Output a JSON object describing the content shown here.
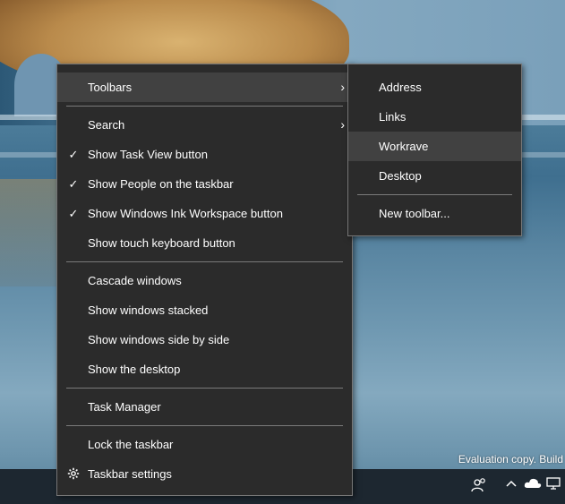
{
  "watermark": "Evaluation copy. Build",
  "context_menu": {
    "items": [
      {
        "label": "Toolbars",
        "submenu": true
      },
      {
        "label": "Search",
        "submenu": true
      },
      {
        "label": "Show Task View button",
        "checked": true
      },
      {
        "label": "Show People on the taskbar",
        "checked": true
      },
      {
        "label": "Show Windows Ink Workspace button",
        "checked": true
      },
      {
        "label": "Show touch keyboard button",
        "checked": false
      },
      {
        "label": "Cascade windows"
      },
      {
        "label": "Show windows stacked"
      },
      {
        "label": "Show windows side by side"
      },
      {
        "label": "Show the desktop"
      },
      {
        "label": "Task Manager"
      },
      {
        "label": "Lock the taskbar"
      },
      {
        "label": "Taskbar settings",
        "icon": "gear-icon"
      }
    ],
    "check_glyph": "✓",
    "submenu_arrow": "›"
  },
  "toolbars_submenu": {
    "items": [
      {
        "label": "Address"
      },
      {
        "label": "Links"
      },
      {
        "label": "Workrave",
        "highlighted": true
      },
      {
        "label": "Desktop"
      },
      {
        "label": "New toolbar..."
      }
    ]
  },
  "taskbar": {
    "icons": [
      "people-icon",
      "chevron-up-icon",
      "onedrive-cloud-icon",
      "network-icon"
    ]
  },
  "colors": {
    "menu_background": "#2b2b2b",
    "menu_hover": "#414141",
    "menu_text": "#ffffff",
    "taskbar": "#1d2730"
  }
}
